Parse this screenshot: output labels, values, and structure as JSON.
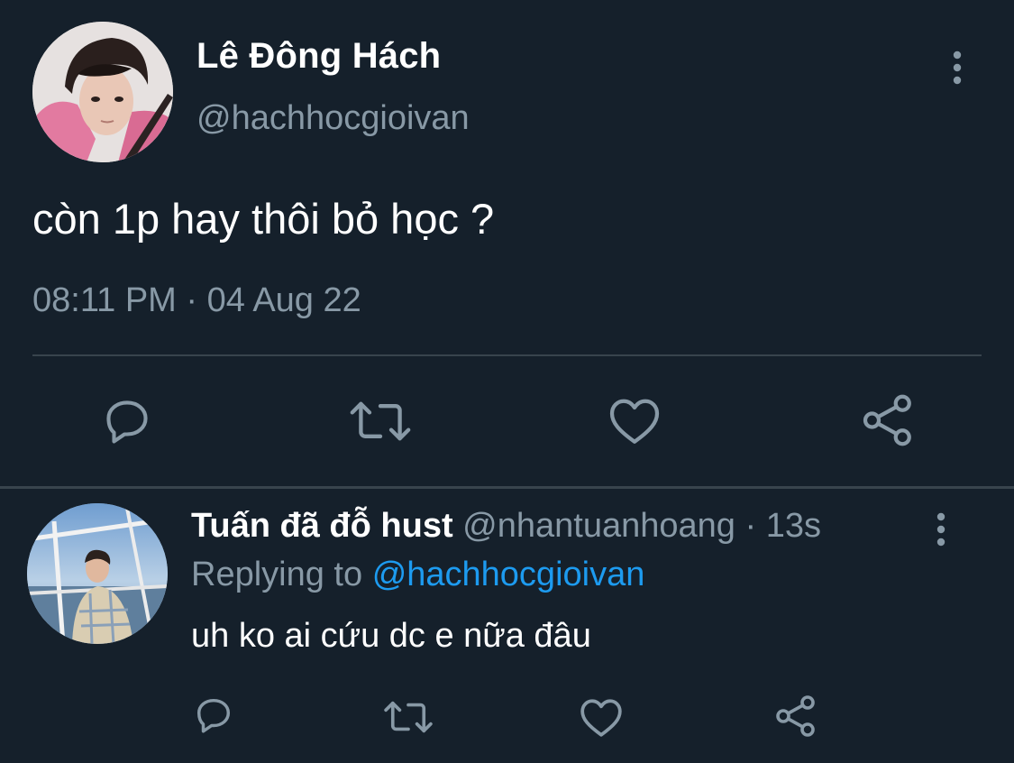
{
  "main_tweet": {
    "author_name": "Lê Đông Hách",
    "handle": "@hachhocgioivan",
    "text": "còn 1p hay thôi bỏ học ?",
    "timestamp": "08:11 PM · 04 Aug 22",
    "more_icon": "more-vertical-icon",
    "actions": [
      "reply-icon",
      "retweet-icon",
      "like-icon",
      "share-icon"
    ]
  },
  "reply": {
    "author_name": "Tuấn đã đỗ hust",
    "handle": "@nhantuanhoang",
    "time": "· 13s",
    "replying_to_label": "Replying to",
    "replying_to_handle": "@hachhocgioivan",
    "text": "uh ko ai cứu dc e nữa đâu",
    "more_icon": "more-vertical-icon",
    "actions": [
      "reply-icon",
      "retweet-icon",
      "like-icon",
      "share-icon"
    ]
  },
  "colors": {
    "background": "#15202b",
    "divider": "#38444d",
    "primary_text": "#ffffff",
    "secondary_text": "#8899a6",
    "accent": "#1d9bf0"
  }
}
